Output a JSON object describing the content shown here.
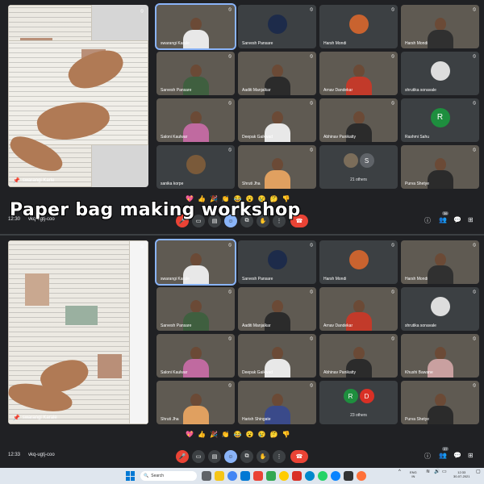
{
  "banner": "Paper bag making workshop",
  "reactions": [
    "💖",
    "👍",
    "🎉",
    "👏",
    "😂",
    "😮",
    "😢",
    "🤔",
    "👎"
  ],
  "top": {
    "pinned_name": "swarangi Karle",
    "clock": "12:30",
    "meeting_code": "vkq-ugtj-coo",
    "people_count": "36",
    "tiles": [
      {
        "name": "swarangi Karale",
        "kind": "video",
        "body": "#e8e8e8",
        "speaking": true
      },
      {
        "name": "Sarvesh Pansare",
        "kind": "logo",
        "color": "#1d2b4a"
      },
      {
        "name": "Harsh Mondi",
        "kind": "photo",
        "color": "#c9632f"
      },
      {
        "name": "Harsh Mondi",
        "kind": "video",
        "body": "#303030"
      },
      {
        "name": "Sarvesh Pansare",
        "kind": "video",
        "body": "#3f5f3f"
      },
      {
        "name": "Aaditi Manjalkar",
        "kind": "video",
        "body": "#2b2b2b"
      },
      {
        "name": "Arnav Dandekar",
        "kind": "video",
        "body": "#c23a2a"
      },
      {
        "name": "shrutika sonavale",
        "kind": "photo",
        "color": "#ddd"
      },
      {
        "name": "Saloni Kaulwar",
        "kind": "video",
        "body": "#c06aa0"
      },
      {
        "name": "Deepak Gaikwad",
        "kind": "video",
        "body": "#e8e8e8"
      },
      {
        "name": "Abhinav Panikatty",
        "kind": "video",
        "body": "#2b2b2b"
      },
      {
        "name": "Rashmi Sahu",
        "kind": "initial",
        "initial": "R",
        "color": "#1e8e3e"
      },
      {
        "name": "sanika korpe",
        "kind": "photo",
        "color": "#7a5a3a"
      },
      {
        "name": "Shruti Jha",
        "kind": "video",
        "body": "#e0a060"
      },
      {
        "name": "21 others",
        "kind": "others",
        "initials": [
          "",
          "S"
        ],
        "colors": [
          "#7b6d5a",
          "#5f6368"
        ]
      },
      {
        "name": "Purva Shetye",
        "kind": "video",
        "body": "#2b2b2b"
      }
    ]
  },
  "bottom": {
    "pinned_name": "swarangi Karale",
    "clock": "12:33",
    "meeting_code": "vkq-ugtj-coo",
    "people_count": "37",
    "tiles": [
      {
        "name": "swarangi Karale",
        "kind": "video",
        "body": "#e8e8e8",
        "speaking": true
      },
      {
        "name": "Sarvesh Pansare",
        "kind": "logo",
        "color": "#1d2b4a"
      },
      {
        "name": "Harsh Mondi",
        "kind": "photo",
        "color": "#c9632f"
      },
      {
        "name": "Harsh Mondi",
        "kind": "video",
        "body": "#303030"
      },
      {
        "name": "Sarvesh Pansare",
        "kind": "video",
        "body": "#3f5f3f"
      },
      {
        "name": "Aaditi Manjalkar",
        "kind": "video",
        "body": "#2b2b2b"
      },
      {
        "name": "Arnav Dandekar",
        "kind": "video",
        "body": "#c23a2a"
      },
      {
        "name": "shrutika sonavale",
        "kind": "photo",
        "color": "#ddd"
      },
      {
        "name": "Saloni Kaulwar",
        "kind": "video",
        "body": "#c06aa0"
      },
      {
        "name": "Deepak Gaikwad",
        "kind": "video",
        "body": "#e8e8e8"
      },
      {
        "name": "Abhinav Panikatty",
        "kind": "video",
        "body": "#2b2b2b"
      },
      {
        "name": "Khushi Bawane",
        "kind": "video",
        "body": "#c9a0a0"
      },
      {
        "name": "Shruti Jha",
        "kind": "video",
        "body": "#e0a060"
      },
      {
        "name": "Harish Shingate",
        "kind": "video",
        "body": "#3a4a8a"
      },
      {
        "name": "23 others",
        "kind": "others",
        "initials": [
          "R",
          "D"
        ],
        "colors": [
          "#1e8e3e",
          "#d93025"
        ]
      },
      {
        "name": "Purva Shetye",
        "kind": "video",
        "body": "#2b2b2b"
      }
    ]
  },
  "taskbar": {
    "search_placeholder": "Search",
    "lang": "ENG",
    "lang_sub": "IN",
    "time": "12:33",
    "date": "30-07-2021"
  }
}
